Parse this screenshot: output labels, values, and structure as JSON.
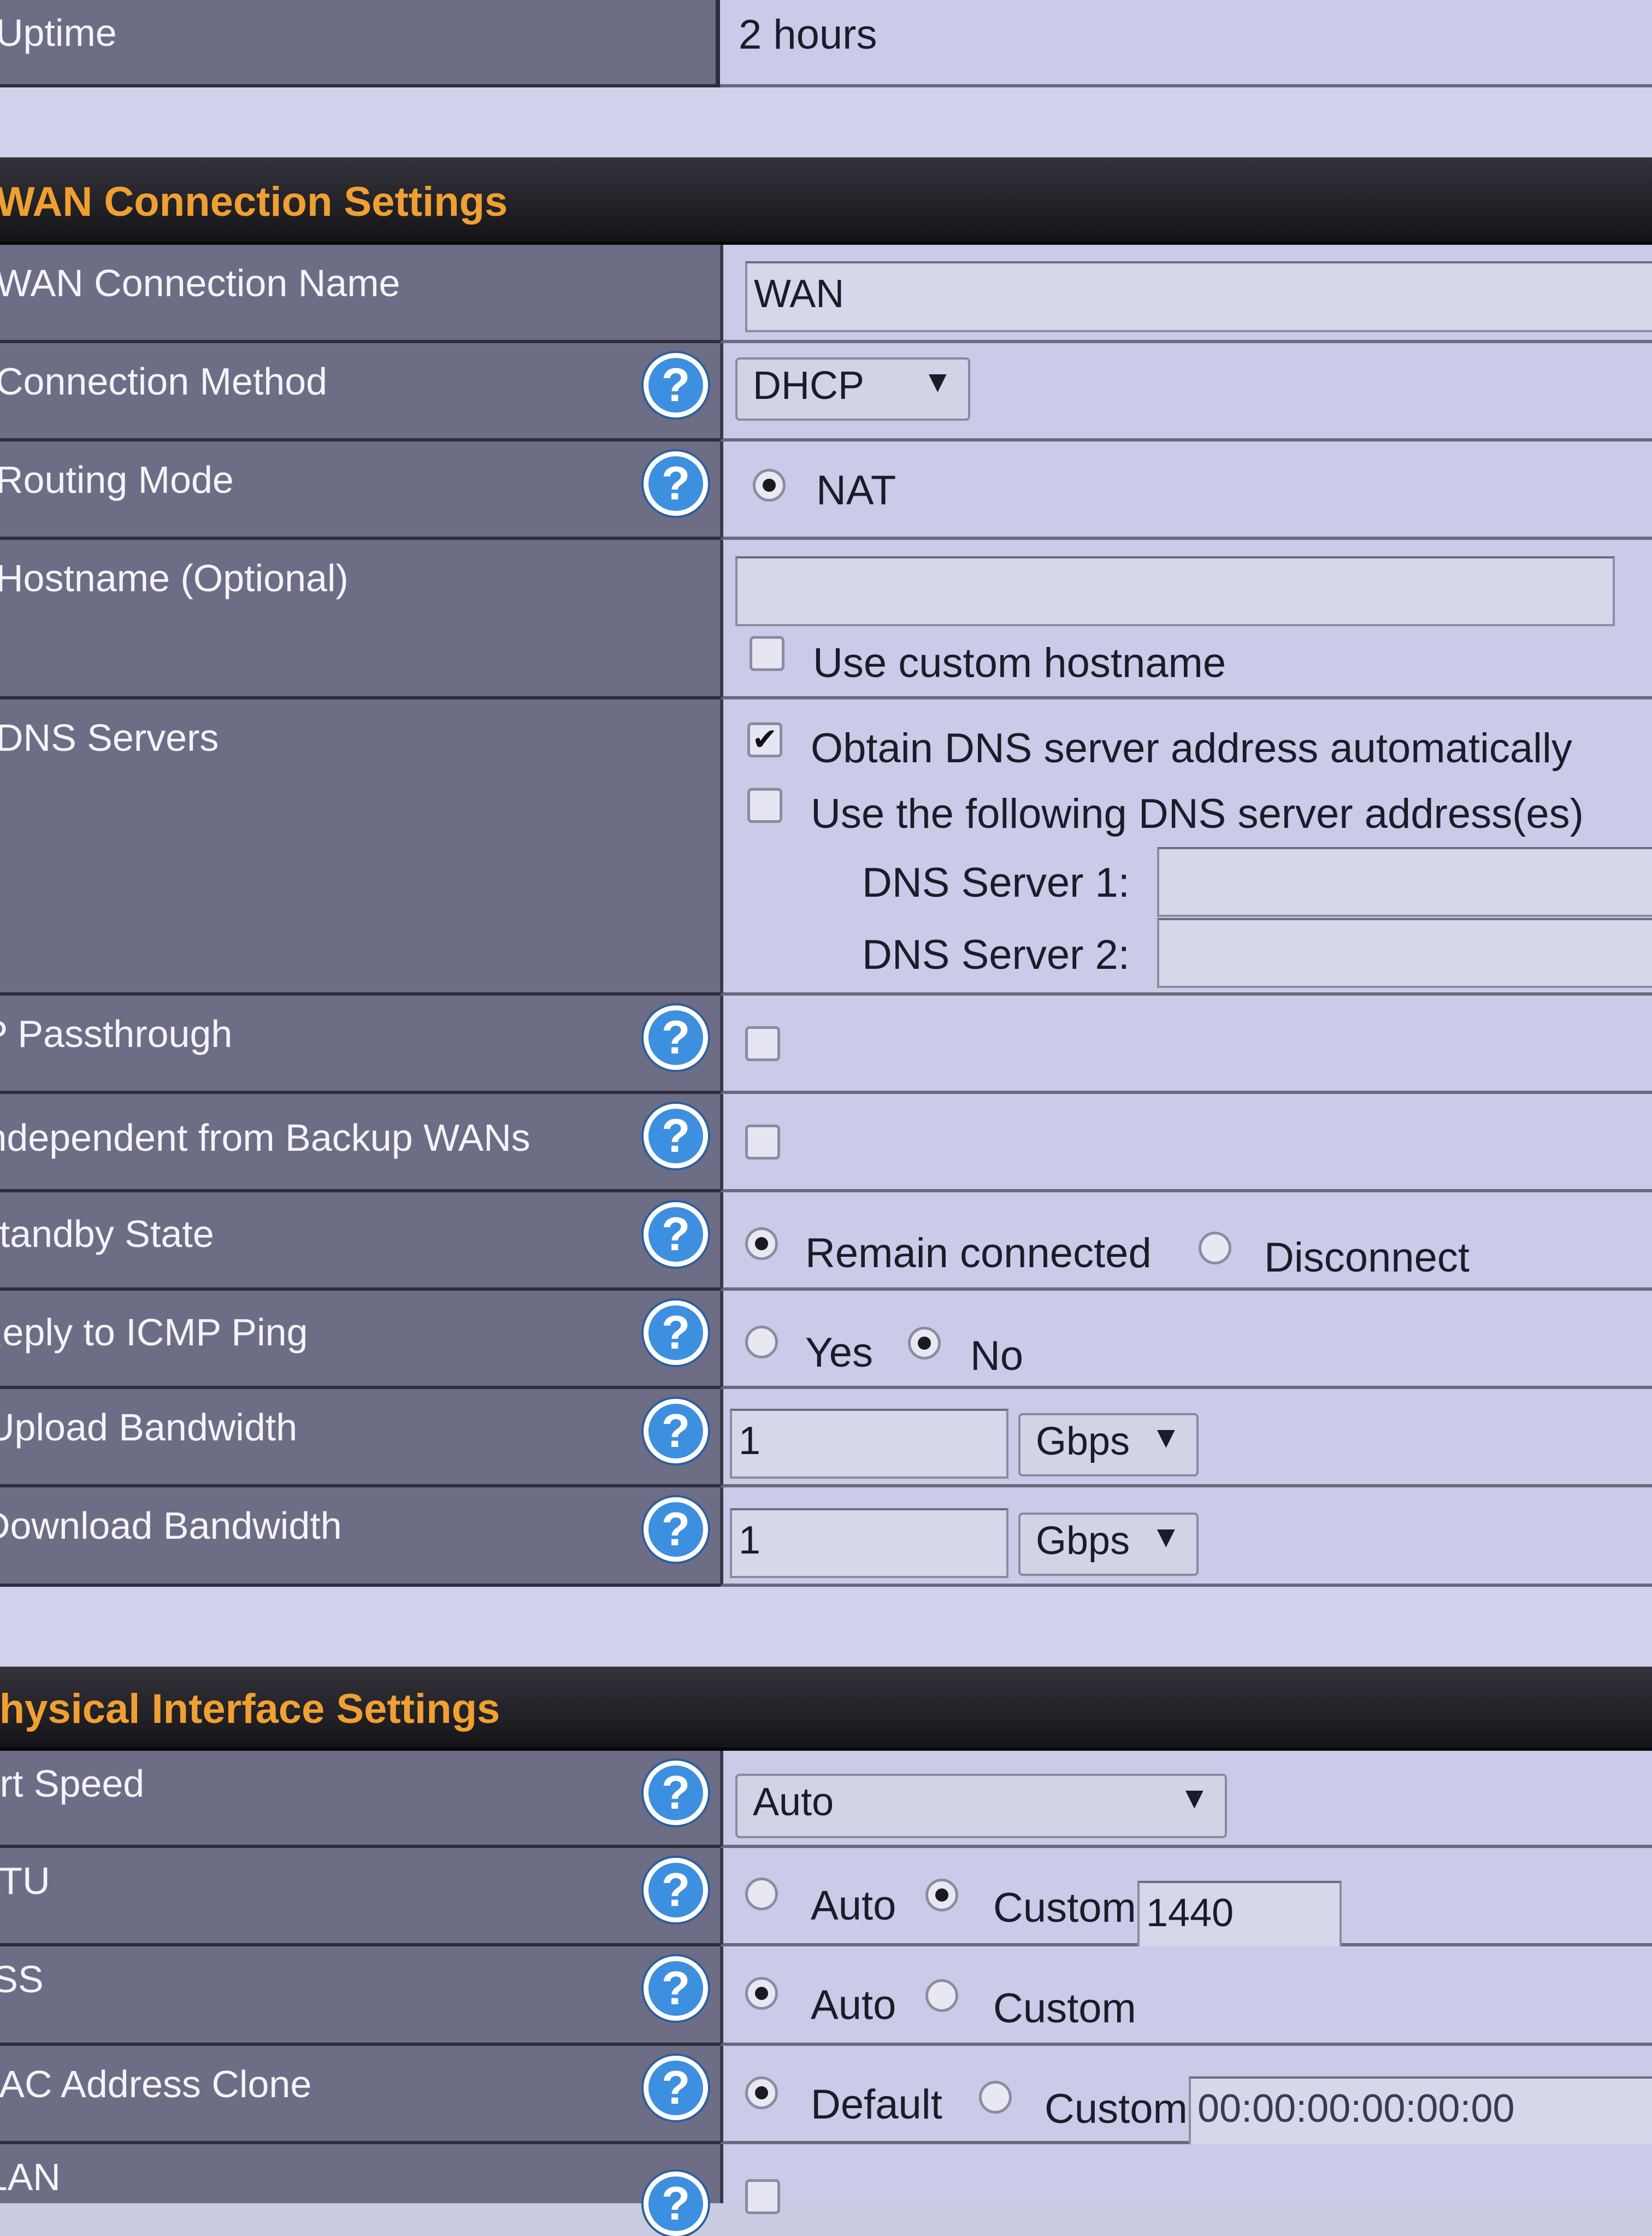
{
  "uptime": {
    "label": "Uptime",
    "value": "2 hours"
  },
  "wan_section": {
    "title": "WAN Connection Settings",
    "connection_name": {
      "label": "WAN Connection Name",
      "value": "WAN"
    },
    "connection_method": {
      "label": "Connection Method",
      "selected": "DHCP"
    },
    "routing_mode": {
      "label": "Routing Mode",
      "option": "NAT",
      "selected": true
    },
    "hostname": {
      "label": "Hostname (Optional)",
      "value": "",
      "custom_label": "Use custom hostname",
      "custom_checked": false
    },
    "dns": {
      "label": "DNS Servers",
      "auto_label": "Obtain DNS server address automatically",
      "auto_checked": true,
      "manual_label": "Use the following DNS server address(es)",
      "manual_checked": false,
      "server1_label": "DNS Server 1:",
      "server1_value": "",
      "server2_label": "DNS Server 2:",
      "server2_value": ""
    },
    "ip_passthrough": {
      "label": "IP Passthrough",
      "checked": false
    },
    "independent_backup": {
      "label": "Independent from Backup WANs",
      "checked": false
    },
    "standby_state": {
      "label": "Standby State",
      "options": [
        "Remain connected",
        "Disconnect"
      ],
      "selected": "Remain connected"
    },
    "icmp_ping": {
      "label": "Reply to ICMP Ping",
      "options": [
        "Yes",
        "No"
      ],
      "selected": "No"
    },
    "upload": {
      "label": "Upload Bandwidth",
      "value": "1",
      "unit": "Gbps"
    },
    "download": {
      "label": "Download Bandwidth",
      "value": "1",
      "unit": "Gbps"
    }
  },
  "phys_section": {
    "title": "Physical Interface Settings",
    "port_speed": {
      "label": "Port Speed",
      "selected": "Auto"
    },
    "mtu": {
      "label": "MTU",
      "options": [
        "Auto",
        "Custom"
      ],
      "selected": "Custom",
      "value": "1440"
    },
    "mss": {
      "label": "MSS",
      "options": [
        "Auto",
        "Custom"
      ],
      "selected": "Auto"
    },
    "mac_clone": {
      "label": "MAC Address Clone",
      "options": [
        "Default",
        "Custom"
      ],
      "selected": "Default",
      "value": "00:00:00:00:00:00"
    },
    "vlan": {
      "label": "VLAN",
      "checked": false
    }
  },
  "icons": {
    "help": "?",
    "dropdown": "▼",
    "check": "✔"
  },
  "colors": {
    "section_title": "#f0a031",
    "help_icon": "#3d8fe0",
    "label_bg": "#6e6d86",
    "value_bg": "#c9cbe8"
  }
}
